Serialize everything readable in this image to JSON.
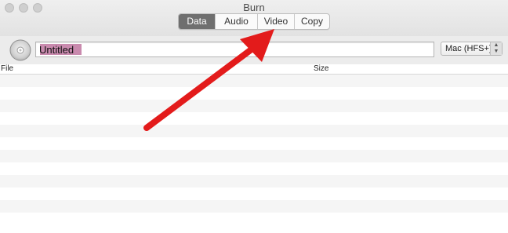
{
  "window": {
    "title": "Burn"
  },
  "tabs": [
    {
      "label": "Data",
      "active": true
    },
    {
      "label": "Audio",
      "active": false
    },
    {
      "label": "Video",
      "active": false
    },
    {
      "label": "Copy",
      "active": false
    }
  ],
  "toolbar": {
    "disc_name": "Untitled",
    "filesystem": "Mac (HFS+)"
  },
  "file_list": {
    "columns": [
      "File",
      "Size"
    ],
    "rows": []
  },
  "colors": {
    "active_tab": "#6f6f6f",
    "selection": "#c98aae",
    "annotation_arrow": "#e31b1b"
  },
  "icons": [
    "disc-icon",
    "select-arrows-icon"
  ]
}
